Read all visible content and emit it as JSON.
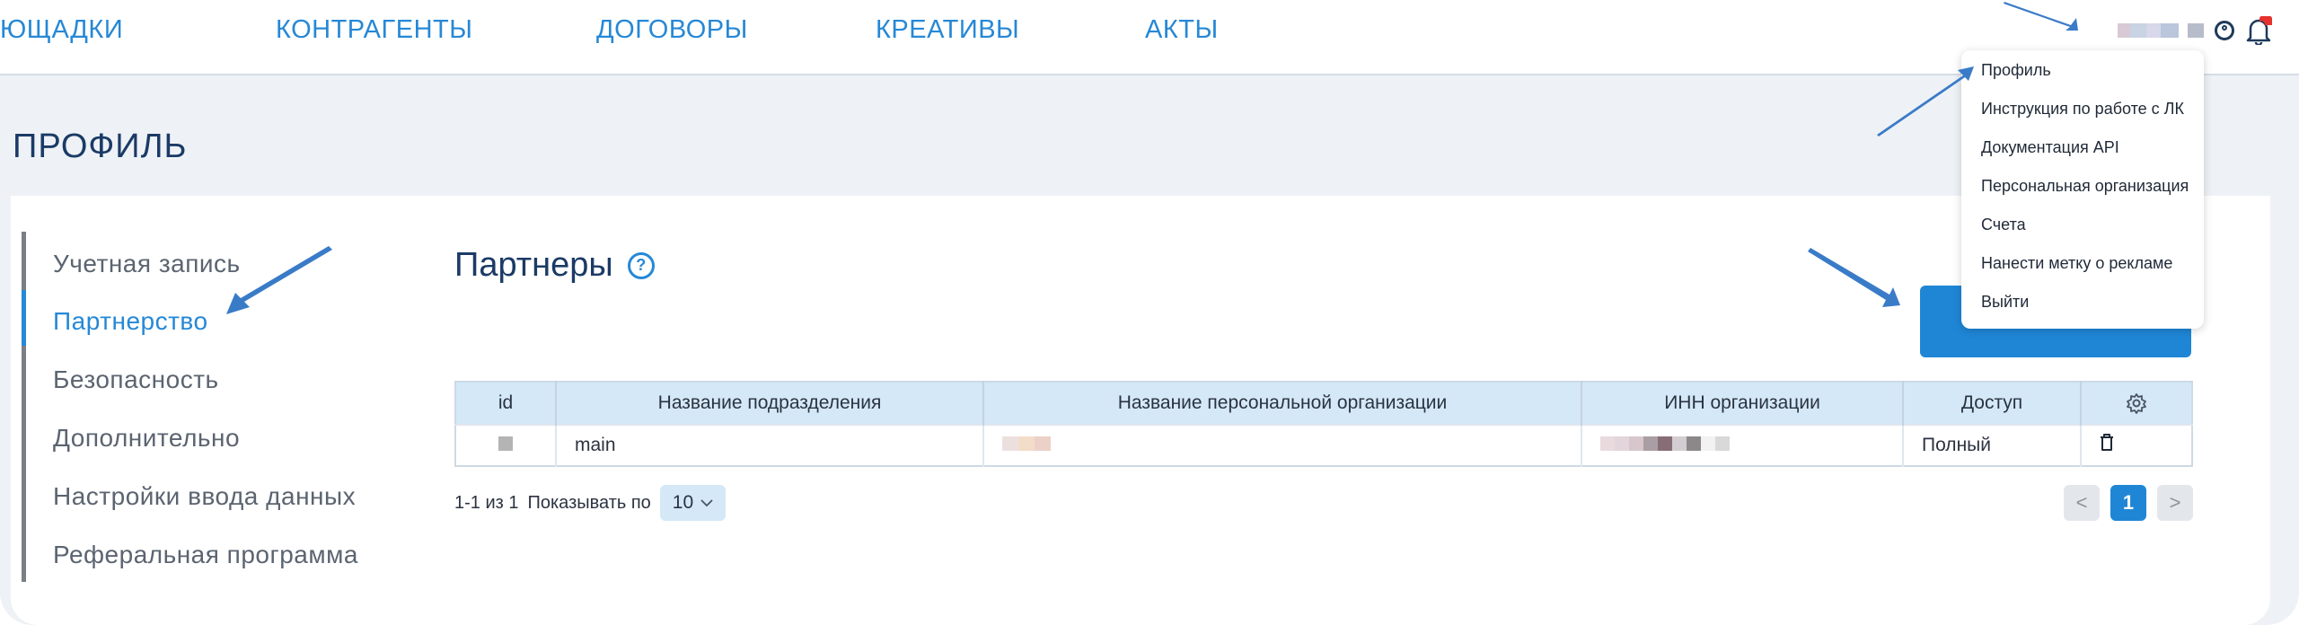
{
  "nav": {
    "items": [
      "ЮЩАДКИ",
      "КОНТРАГЕНТЫ",
      "ДОГОВОРЫ",
      "КРЕАТИВЫ",
      "АКТЫ"
    ]
  },
  "page": {
    "title": "ПРОФИЛЬ"
  },
  "sidebar": {
    "items": [
      {
        "label": "Учетная запись"
      },
      {
        "label": "Партнерство"
      },
      {
        "label": "Безопасность"
      },
      {
        "label": "Дополнительно"
      },
      {
        "label": "Настройки ввода данных"
      },
      {
        "label": "Реферальная программа"
      }
    ],
    "active_index": 1
  },
  "section": {
    "title": "Партнеры",
    "help_glyph": "?"
  },
  "table": {
    "headers": [
      "id",
      "Название подразделения",
      "Название персональной организации",
      "ИНН организации",
      "Доступ",
      ""
    ],
    "rows": [
      {
        "division": "main",
        "access": "Полный"
      }
    ]
  },
  "pagination": {
    "range_text": "1-1 из 1",
    "show_label": "Показывать по",
    "page_size": "10",
    "prev": "<",
    "current": "1",
    "next": ">"
  },
  "user_menu": {
    "items": [
      "Профиль",
      "Инструкция по работе с ЛК",
      "Документация API",
      "Персональная организация",
      "Счета",
      "Нанести метку о рекламе",
      "Выйти"
    ]
  },
  "icons": {
    "user": "user-circle-icon",
    "bell": "bell-icon",
    "help": "help-circle-icon",
    "settings": "gear-icon",
    "delete": "trash-icon",
    "chevron": "chevron-down-icon"
  },
  "colors": {
    "accent": "#1f86d6",
    "nav_text": "#2688d6",
    "heading": "#1b3a66",
    "table_header_bg": "#d4e8f7",
    "arrow": "#3a7bc8",
    "notification": "#e5322d"
  }
}
